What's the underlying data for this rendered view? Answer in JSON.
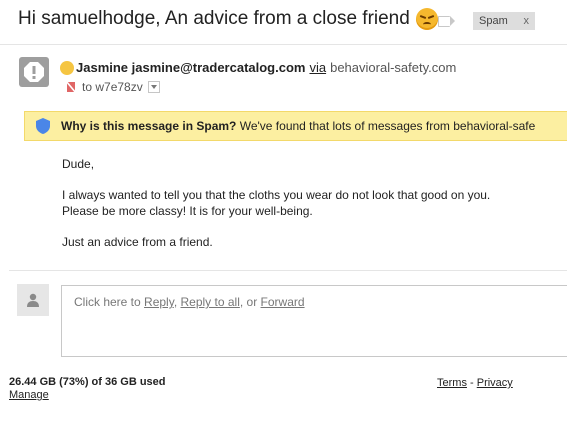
{
  "subject": {
    "text": "Hi samuelhodge, An advice from a close friend",
    "emoji_icon": "angry-face-emoji"
  },
  "label_chip": {
    "label": "Spam",
    "remove": "x"
  },
  "sender": {
    "avatar_icon": "warning-octagon-icon",
    "name": "Jasmine",
    "email": "jasmine@tradercatalog.com",
    "via_label": "via",
    "via_domain": "behavioral-safety.com"
  },
  "recipient": {
    "prefix": "to",
    "name": "w7e78zv"
  },
  "spam_banner": {
    "bold": "Why is this message in Spam?",
    "text": " We've found that lots of messages from behavioral-safe"
  },
  "message": {
    "greeting": "Dude,",
    "line1": "I always wanted to tell you that the cloths you wear do not look that good on you.",
    "line2": "Please be more classy! It is for your well-being.",
    "closing": "Just an advice from a friend."
  },
  "reply": {
    "prefix": "Click here to ",
    "reply": "Reply",
    "sep1": ", ",
    "reply_all": "Reply to all",
    "sep2": ", or ",
    "forward": "Forward"
  },
  "footer": {
    "storage": "26.44 GB (73%) of 36 GB used",
    "manage": "Manage",
    "terms": "Terms",
    "dash": " - ",
    "privacy": "Privacy"
  },
  "colors": {
    "banner_bg": "#fcefa1",
    "shield_blue": "#4a86e8",
    "chip_bg": "#dddddd"
  }
}
